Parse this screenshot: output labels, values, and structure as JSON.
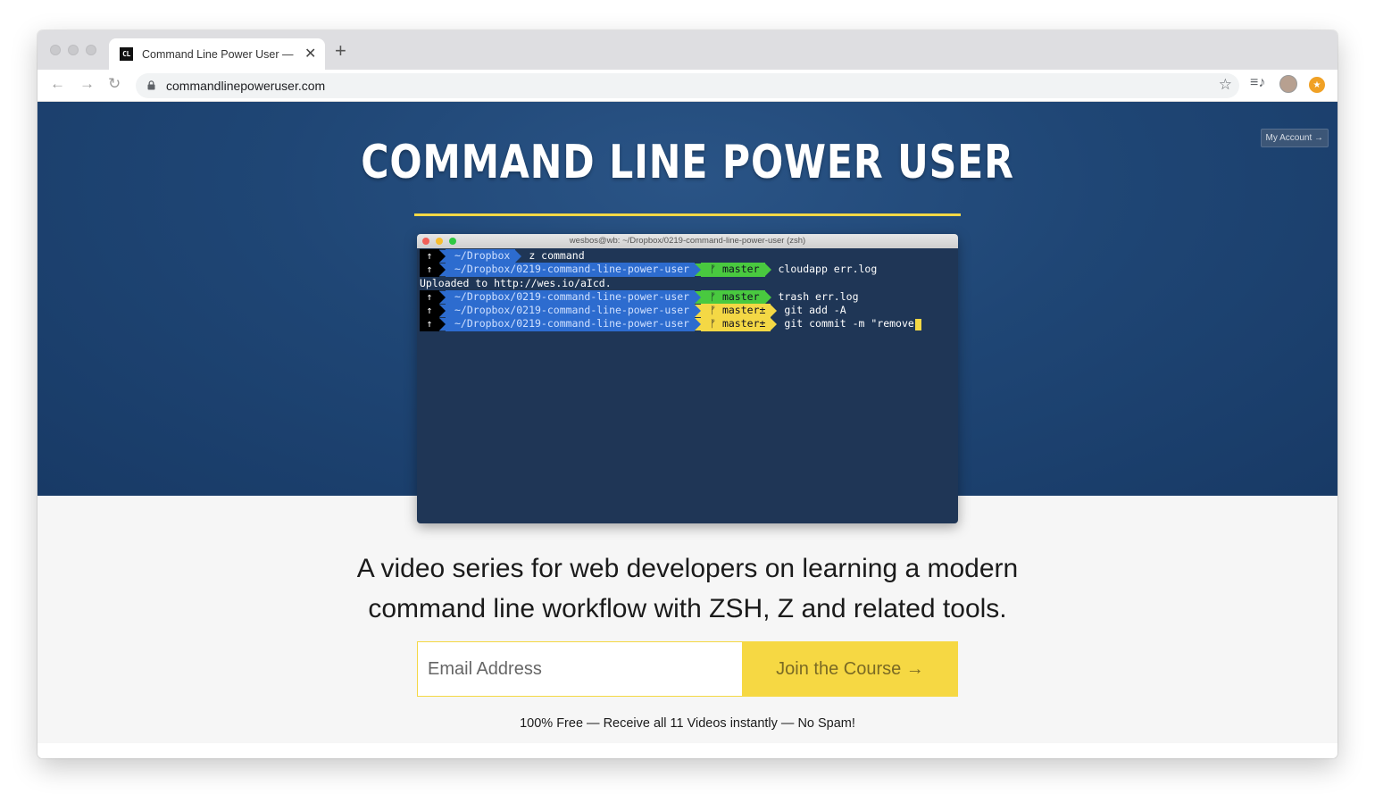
{
  "browser": {
    "tab": {
      "favicon_text": "CL",
      "title": "Command Line Power User —",
      "close_glyph": "✕"
    },
    "new_tab_glyph": "+",
    "nav": {
      "back_glyph": "←",
      "forward_glyph": "→",
      "reload_glyph": "↻"
    },
    "url": "commandlinepoweruser.com",
    "bookmark_glyph": "☆",
    "media_glyph": "≡♪",
    "extension_glyph": "★"
  },
  "hero": {
    "account_button": "My Account →",
    "title": "COMMAND LINE POWER USER",
    "accent_color": "#f4d845",
    "background_color": "#1f4675"
  },
  "terminal": {
    "window_title": "wesbos@wb: ~/Dropbox/0219-command-line-power-user (zsh)",
    "prompt_arrow": "↑",
    "branch_icon": "ᚠ",
    "lines": [
      {
        "path": "~/Dropbox",
        "branch": "",
        "command": "z command"
      },
      {
        "path": "~/Dropbox/0219-command-line-power-user",
        "branch": "master",
        "command": "cloudapp err.log"
      },
      {
        "output": "Uploaded to http://wes.io/aIcd."
      },
      {
        "path": "~/Dropbox/0219-command-line-power-user",
        "branch": "master",
        "command": "trash err.log"
      },
      {
        "path": "~/Dropbox/0219-command-line-power-user",
        "branch": "master±",
        "command": "git add -A"
      },
      {
        "path": "~/Dropbox/0219-command-line-power-user",
        "branch": "master±",
        "command": "git commit -m \"remove"
      }
    ]
  },
  "tagline": {
    "line1": "A video series for web developers on learning a modern",
    "line2": "command line workflow with ZSH, Z and related tools."
  },
  "signup": {
    "email_placeholder": "Email Address",
    "button_label": "Join the Course →",
    "fineprint": "100% Free — Receive all 11 Videos instantly — No Spam!"
  }
}
